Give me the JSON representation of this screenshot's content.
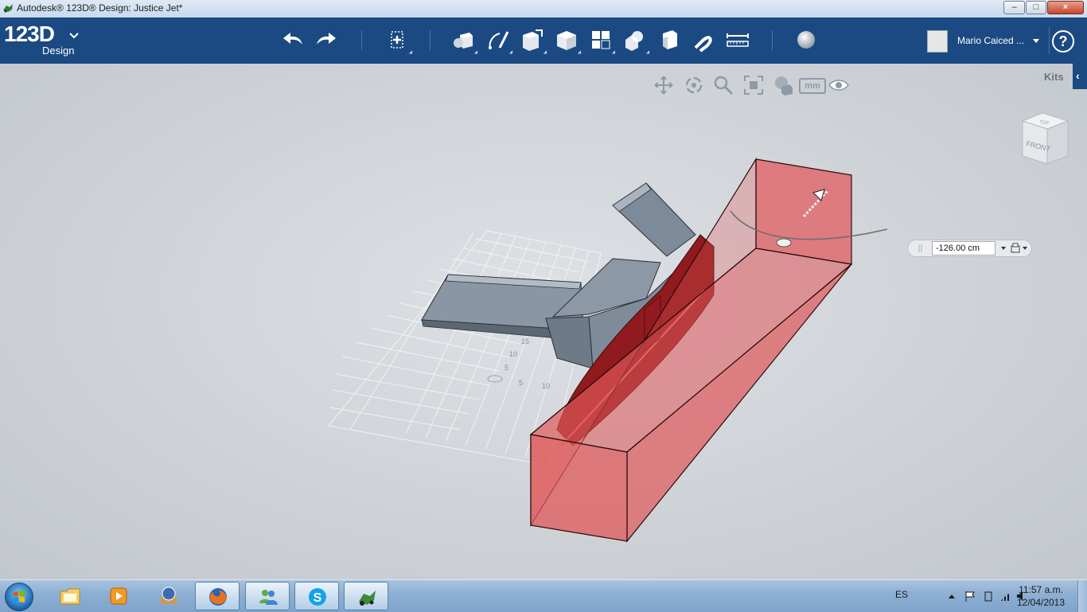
{
  "window": {
    "title": "Autodesk® 123D® Design: Justice Jet*",
    "controls": {
      "minimize": "–",
      "maximize": "□",
      "close": "×"
    }
  },
  "toolbar": {
    "logo_number": "123D",
    "logo_sub": "Design",
    "logo_menu_icon": "chevron-down-icon",
    "buttons": [
      {
        "name": "undo-button",
        "icon": "undo-arrow-icon"
      },
      {
        "name": "redo-button",
        "icon": "redo-arrow-icon"
      },
      {
        "name": "transform-button",
        "icon": "move-icon"
      },
      {
        "name": "primitives-button",
        "icon": "primitives-icon"
      },
      {
        "name": "sketch-button",
        "icon": "sketch-pen-icon"
      },
      {
        "name": "construct-button",
        "icon": "construct-icon"
      },
      {
        "name": "modify-button",
        "icon": "modify-cube-icon"
      },
      {
        "name": "pattern-button",
        "icon": "pattern-grid-icon"
      },
      {
        "name": "grouping-button",
        "icon": "group-icon"
      },
      {
        "name": "combine-button",
        "icon": "combine-icon"
      },
      {
        "name": "snap-button",
        "icon": "magnet-icon"
      },
      {
        "name": "measure-button",
        "icon": "ruler-icon"
      },
      {
        "name": "material-button",
        "icon": "sphere-icon"
      }
    ],
    "user_name": "Mario Caiced ...",
    "help_label": "?"
  },
  "viewport": {
    "kits_label": "Kits",
    "kits_toggle": "‹",
    "nav_tools": [
      {
        "name": "pan-tool",
        "icon": "pan-icon"
      },
      {
        "name": "orbit-tool",
        "icon": "orbit-icon"
      },
      {
        "name": "zoom-tool",
        "icon": "zoom-icon"
      },
      {
        "name": "fit-tool",
        "icon": "fit-icon"
      },
      {
        "name": "visual-style-tool",
        "icon": "visual-style-icon"
      },
      {
        "name": "units-tool",
        "label": "mm"
      },
      {
        "name": "visibility-tool",
        "icon": "eye-icon"
      }
    ],
    "viewcube": {
      "top": "TOP",
      "front": "FRONT"
    },
    "grid_labels": [
      "15",
      "10",
      "5",
      "10",
      "5"
    ],
    "value_input": "-126.00 cm",
    "colors": {
      "selection": "#e0585a",
      "model": "#6f7c8c",
      "toolbar": "#1b4a82"
    }
  },
  "taskbar": {
    "items": [
      {
        "name": "explorer-taskbar",
        "icon": "folder-icon"
      },
      {
        "name": "media-player-taskbar",
        "icon": "media-player-icon"
      },
      {
        "name": "games-taskbar",
        "icon": "games-icon"
      },
      {
        "name": "firefox-taskbar",
        "icon": "firefox-icon"
      },
      {
        "name": "messenger-taskbar",
        "icon": "messenger-icon"
      },
      {
        "name": "skype-taskbar",
        "icon": "skype-icon"
      },
      {
        "name": "123d-taskbar",
        "icon": "123d-app-icon"
      }
    ],
    "language": "ES",
    "time": "11:57 a.m.",
    "date": "12/04/2013"
  }
}
